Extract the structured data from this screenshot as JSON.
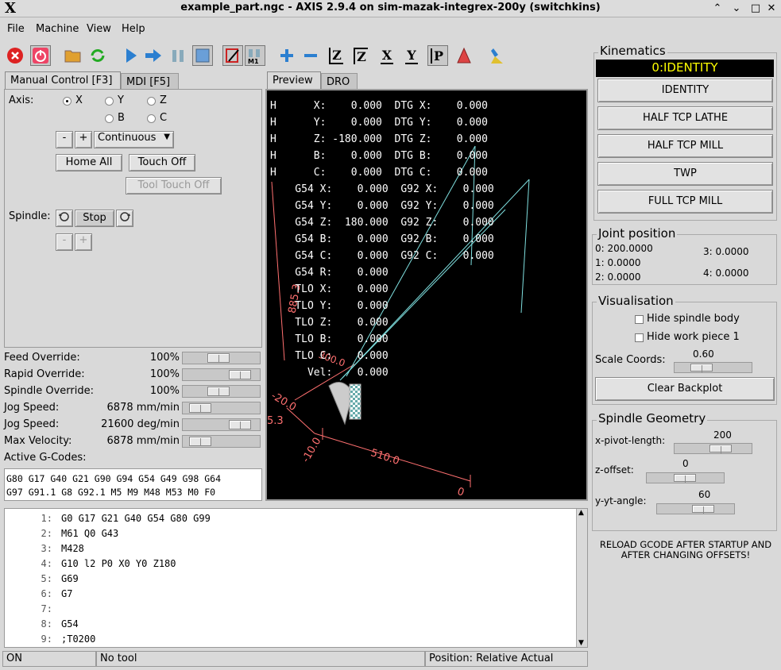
{
  "window": {
    "title": "example_part.ngc - AXIS 2.9.4 on sim-mazak-integrex-200y (switchkins)",
    "logo": "X",
    "controls": [
      "⌃",
      "⌄",
      "□",
      "✕"
    ]
  },
  "menu": [
    "File",
    "Machine",
    "View",
    "Help"
  ],
  "toolbar_icons": [
    "estop-icon",
    "power-icon",
    "open-icon",
    "reload-icon",
    "run-icon",
    "step-icon",
    "pause-icon",
    "stop-icon",
    "block-delete-icon",
    "optional-stop-icon",
    "zoom-in-icon",
    "zoom-out-icon",
    "view-z-icon",
    "view-z2-icon",
    "view-x-icon",
    "view-y-icon",
    "view-p-icon",
    "rotate-icon",
    "clear-icon"
  ],
  "toolbar_letters": {
    "z": "Z",
    "z2": "Z",
    "x": "X",
    "y": "Y",
    "p": "P"
  },
  "left_tabs": [
    "Manual Control [F3]",
    "MDI [F5]"
  ],
  "manual": {
    "axis_label": "Axis:",
    "axes": [
      "X",
      "Y",
      "Z",
      "B",
      "C"
    ],
    "selected_axis": "X",
    "minus": "-",
    "plus": "+",
    "jog_mode": "Continuous",
    "home_all": "Home All",
    "touch_off": "Touch Off",
    "tool_touch_off": "Tool Touch Off",
    "spindle_label": "Spindle:",
    "stop": "Stop",
    "minus2": "-",
    "plus2": "+"
  },
  "overrides": [
    {
      "label": "Feed Override:",
      "value": "100",
      "unit": "%",
      "fraction": 0.45
    },
    {
      "label": "Rapid Override:",
      "value": "100",
      "unit": "%",
      "fraction": 0.85
    },
    {
      "label": "Spindle Override:",
      "value": "100",
      "unit": "%",
      "fraction": 0.45
    },
    {
      "label": "Jog Speed:",
      "value": "6878",
      "unit": "mm/min",
      "fraction": 0.1
    },
    {
      "label": "Jog Speed:",
      "value": "21600",
      "unit": "deg/min",
      "fraction": 0.85
    },
    {
      "label": "Max Velocity:",
      "value": "6878",
      "unit": "mm/min",
      "fraction": 0.1
    }
  ],
  "gcodes": {
    "label": "Active G-Codes:",
    "line1": "G80 G17 G40 G21 G90 G94 G54 G49 G98 G64",
    "line2": "G97 G91.1 G8 G92.1 M5 M9 M48 M53 M0 F0"
  },
  "preview_tabs": [
    "Preview",
    "DRO"
  ],
  "dro": [
    "H      X:    0.000  DTG X:    0.000",
    "H      Y:    0.000  DTG Y:    0.000",
    "H      Z: -180.000  DTG Z:    0.000",
    "H      B:    0.000  DTG B:    0.000",
    "H      C:    0.000  DTG C:    0.000",
    "    G54 X:    0.000  G92 X:    0.000",
    "    G54 Y:    0.000  G92 Y:    0.000",
    "    G54 Z:  180.000  G92 Z:    0.000",
    "    G54 B:    0.000  G92 B:    0.000",
    "    G54 C:    0.000  G92 C:    0.000",
    "    G54 R:    0.000",
    "    TLO X:    0.000",
    "    TLO Y:    0.000",
    "    TLO Z:    0.000",
    "    TLO B:    0.000",
    "    TLO C:    0.000",
    "      Vel:    0.000"
  ],
  "plot_labels": {
    "a": "885.3",
    "b": "-20.0",
    "c": "5.3",
    "d": "-10.0",
    "e": "510.0",
    "f": "0",
    "g": "300.0"
  },
  "kinematics": {
    "title": "Kinematics",
    "current": "0:IDENTITY",
    "buttons": [
      "IDENTITY",
      "HALF TCP LATHE",
      "HALF TCP MILL",
      "TWP",
      "FULL TCP MILL"
    ]
  },
  "joints": {
    "title": "Joint position",
    "j0": "0:  200.0000",
    "j1": "1:  0.0000",
    "j2": "2:  0.0000",
    "j3": "3:  0.0000",
    "j4": "4:  0.0000"
  },
  "visual": {
    "title": "Visualisation",
    "hide_spindle": "Hide spindle body",
    "hide_work": "Hide work piece 1",
    "scale_label": "Scale Coords:",
    "scale_value": "0.60",
    "clear": "Clear Backplot"
  },
  "spindle_geom": {
    "title": "Spindle Geometry",
    "x_label": "x-pivot-length:",
    "x_value": "200",
    "z_label": "z-offset:",
    "z_value": "0",
    "y_label": "y-yt-angle:",
    "y_value": "60"
  },
  "reload_note": "RELOAD GCODE AFTER STARTUP AND AFTER CHANGING OFFSETS!",
  "program": [
    {
      "n": "1:",
      "t": "G0 G17 G21 G40 G54 G80 G99"
    },
    {
      "n": "2:",
      "t": "M61 Q0 G43"
    },
    {
      "n": "3:",
      "t": "M428"
    },
    {
      "n": "4:",
      "t": "G10 l2 P0 X0 Y0 Z180"
    },
    {
      "n": "5:",
      "t": "G69"
    },
    {
      "n": "6:",
      "t": "G7"
    },
    {
      "n": "7:",
      "t": ""
    },
    {
      "n": "8:",
      "t": "G54"
    },
    {
      "n": "9:",
      "t": ";T0200"
    }
  ],
  "status": {
    "state": "ON",
    "tool": "No tool",
    "position": "Position: Relative Actual"
  }
}
